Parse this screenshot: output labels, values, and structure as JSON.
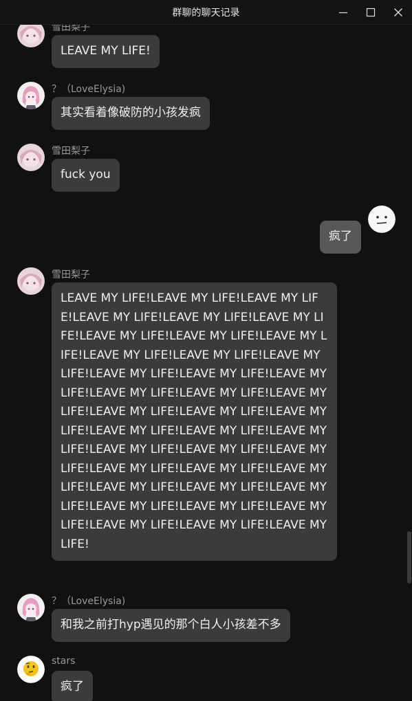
{
  "window": {
    "title": "群聊的聊天记录",
    "controls": [
      "minimize-icon",
      "maximize-icon",
      "close-icon"
    ]
  },
  "colors": {
    "background": "#111111",
    "bubble_other": "#3b3b3b",
    "bubble_self": "#585858",
    "sender_text": "#9a9a9a"
  },
  "messages": [
    {
      "sender": "雪田梨子",
      "avatar": "pink-hair-avatar",
      "text": "LEAVE MY LIFE!"
    },
    {
      "sender": "？（LoveElysia)",
      "avatar": "anime-girl-avatar",
      "text": "其实看着像破防的小孩发疯"
    },
    {
      "sender": "雪田梨子",
      "avatar": "pink-hair-avatar",
      "text": "fuck you"
    },
    {
      "sender": "",
      "avatar": "neutral-face-avatar",
      "text": "疯了",
      "self": true
    },
    {
      "sender": "雪田梨子",
      "avatar": "pink-hair-avatar",
      "text": "LEAVE MY LIFE!LEAVE MY LIFE!LEAVE MY LIFE!LEAVE MY LIFE!LEAVE MY LIFE!LEAVE MY LIFE!LEAVE MY LIFE!LEAVE MY LIFE!LEAVE MY LIFE!LEAVE MY LIFE!LEAVE MY LIFE!LEAVE MY LIFE!LEAVE MY LIFE!LEAVE MY LIFE!LEAVE MY LIFE!LEAVE MY LIFE!LEAVE MY LIFE!LEAVE MY LIFE!LEAVE MY LIFE!LEAVE MY LIFE!LEAVE MY LIFE!LEAVE MY LIFE!LEAVE MY LIFE!LEAVE MY LIFE!LEAVE MY LIFE!LEAVE MY LIFE!LEAVE MY LIFE!LEAVE MY LIFE!LEAVE MY LIFE!LEAVE MY LIFE!LEAVE MY LIFE!LEAVE MY LIFE!LEAVE MY LIFE!LEAVE MY LIFE!LEAVE MY LIFE!LEAVE MY LIFE!LEAVE MY LIFE!LEAVE MY LIFE!LEAVE MY LIFE!"
    },
    {
      "sender": "？（LoveElysia)",
      "avatar": "anime-girl-avatar",
      "text": "和我之前打hyp遇见的那个白人小孩差不多"
    },
    {
      "sender": "stars",
      "avatar": "thinking-face-avatar",
      "text": "疯了"
    }
  ]
}
